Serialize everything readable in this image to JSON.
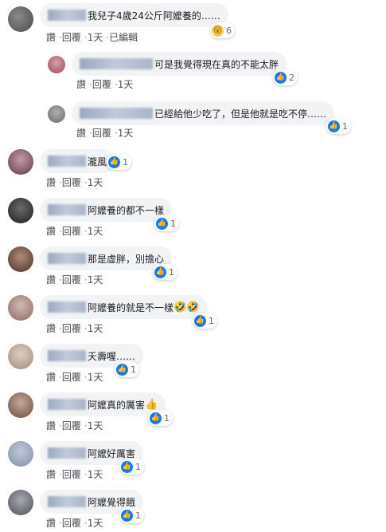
{
  "labels": {
    "like": "讚",
    "reply": "回覆",
    "dot": "·"
  },
  "comments": [
    {
      "text": "我兒子4歲24公斤阿嬤養的……",
      "time": "1天",
      "edited": "已編輯",
      "reaction": "wow-icon",
      "count": "6"
    },
    {
      "text": "可是我覺得現在真的不能太胖",
      "time": "1天",
      "reaction": "like-icon",
      "count": "2"
    },
    {
      "text": "已經給他少吃了，但是他就是吃不停……",
      "time": "1天",
      "reaction": "like-icon",
      "count": "1"
    },
    {
      "text": "瀧風",
      "time": "1天",
      "reaction": "like-icon",
      "count": "1"
    },
    {
      "text": "阿嬤養的都不一樣",
      "time": "1天",
      "reaction": "like-icon",
      "count": "1"
    },
    {
      "text": "那是虛胖，別擔心",
      "time": "1天",
      "reaction": "like-icon",
      "count": "1"
    },
    {
      "text": "阿嬤養的就是不一樣",
      "emoji": "🤣🤣",
      "time": "1天",
      "reaction": "like-icon",
      "count": "1"
    },
    {
      "text": "夭壽喔……",
      "time": "1天",
      "reaction": "like-icon",
      "count": "1"
    },
    {
      "text": "阿嬤真的厲害",
      "emoji": "👍",
      "time": "1天",
      "reaction": "like-icon",
      "count": "1"
    },
    {
      "text": "阿嬤好厲害",
      "time": "1天",
      "reaction": "like-icon",
      "count": "1"
    },
    {
      "text": "阿嬤覺得餓",
      "time": "1天",
      "reaction": "like-icon",
      "count": "1"
    }
  ]
}
